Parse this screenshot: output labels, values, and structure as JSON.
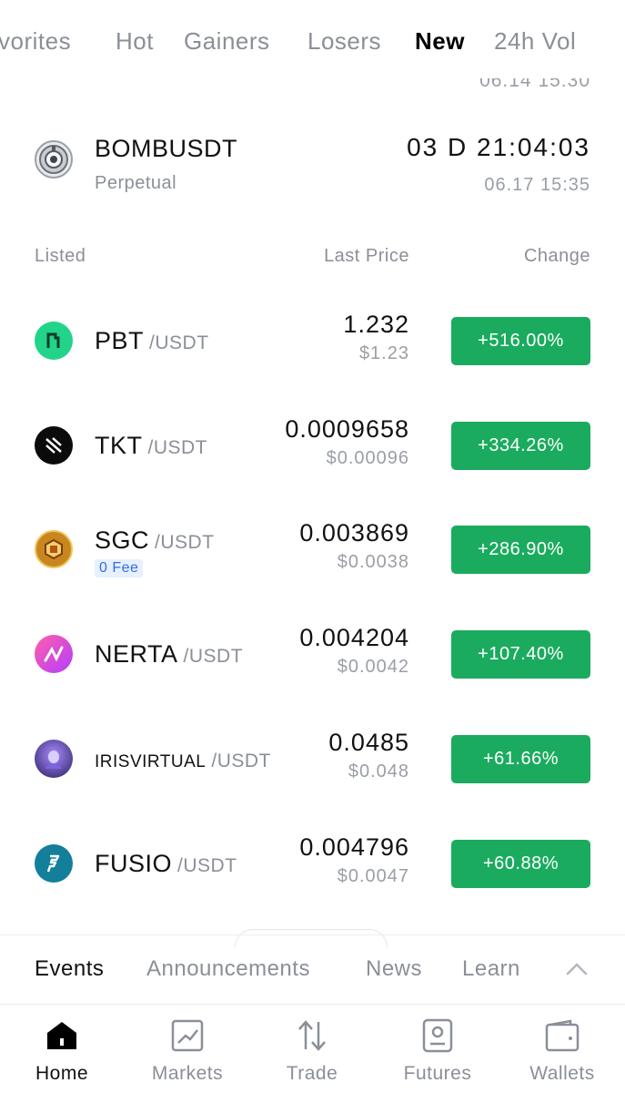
{
  "tabs": [
    "vorites",
    "Hot",
    "Gainers",
    "Losers",
    "New",
    "24h Vol"
  ],
  "active_tab": "New",
  "prev_item_time": "06.14 15:30",
  "upcoming": {
    "symbol": "BOMBUSDT",
    "type": "Perpetual",
    "countdown": "03 D 21:04:03",
    "date": "06.17 15:35",
    "icon": "bomb-coin-icon"
  },
  "columns": {
    "listed": "Listed",
    "last_price": "Last Price",
    "change": "Change"
  },
  "rows": [
    {
      "base": "PBT",
      "quote": "/USDT",
      "price": "1.232",
      "usd": "$1.23",
      "change": "+516.00%",
      "icon": "pbt-coin-icon",
      "badge": ""
    },
    {
      "base": "TKT",
      "quote": "/USDT",
      "price": "0.0009658",
      "usd": "$0.00096",
      "change": "+334.26%",
      "icon": "tkt-coin-icon",
      "badge": ""
    },
    {
      "base": "SGC",
      "quote": "/USDT",
      "price": "0.003869",
      "usd": "$0.0038",
      "change": "+286.90%",
      "icon": "sgc-coin-icon",
      "badge": "0 Fee"
    },
    {
      "base": "NERTA",
      "quote": "/USDT",
      "price": "0.004204",
      "usd": "$0.0042",
      "change": "+107.40%",
      "icon": "nerta-coin-icon",
      "badge": ""
    },
    {
      "base": "IRISVIRTUAL",
      "quote": "/USDT",
      "price": "0.0485",
      "usd": "$0.048",
      "change": "+61.66%",
      "icon": "irisvirtual-coin-icon",
      "badge": ""
    },
    {
      "base": "FUSIO",
      "quote": "/USDT",
      "price": "0.004796",
      "usd": "$0.0047",
      "change": "+60.88%",
      "icon": "fusio-coin-icon",
      "badge": ""
    }
  ],
  "section_tabs": [
    "Events",
    "Announcements",
    "News",
    "Learn"
  ],
  "active_section_tab": "Events",
  "nav": [
    {
      "label": "Home",
      "icon": "home-icon"
    },
    {
      "label": "Markets",
      "icon": "markets-icon"
    },
    {
      "label": "Trade",
      "icon": "trade-icon"
    },
    {
      "label": "Futures",
      "icon": "futures-icon"
    },
    {
      "label": "Wallets",
      "icon": "wallet-icon"
    }
  ],
  "colors": {
    "positive": "#1bab5f",
    "muted": "#8a8f98",
    "text": "#111111",
    "badge_bg": "#e6f0ff",
    "badge_text": "#2f6fe0"
  }
}
